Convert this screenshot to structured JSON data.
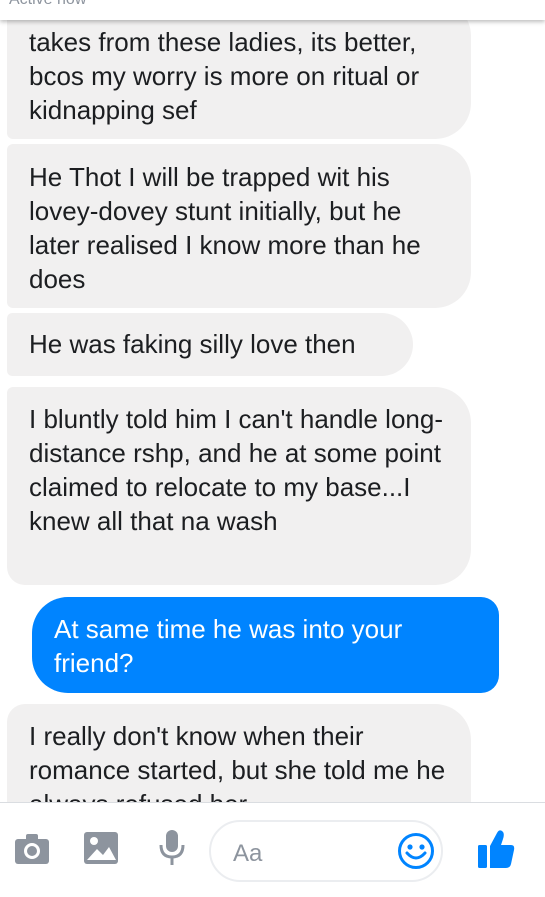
{
  "header": {
    "status": "Active now"
  },
  "messages": [
    {
      "from": "them",
      "text": "takes from these ladies, its better, bcos my worry is more on ritual or kidnapping sef"
    },
    {
      "from": "them",
      "text": "He Thot I will be trapped wit his lovey-dovey stunt initially, but he later realised I know more than he does"
    },
    {
      "from": "them",
      "text": "He was faking silly love then"
    },
    {
      "from": "them",
      "text": "I bluntly told him I can't handle long-distance rshp, and he at some point claimed to relocate to my base...I knew all that na wash"
    },
    {
      "from": "me",
      "text": "At same time he was into your friend?"
    },
    {
      "from": "them",
      "text": "I really don't know when their romance started, but she told me he always refused her"
    }
  ],
  "composer": {
    "placeholder": "Aa",
    "icons": [
      "camera-icon",
      "gallery-icon",
      "microphone-icon",
      "emoji-icon",
      "thumbs-up-icon"
    ]
  },
  "colors": {
    "sent_bubble": "#0084ff",
    "received_bubble": "#f1f0f0",
    "accent": "#0084ff",
    "icon_gray": "#8d949e"
  }
}
